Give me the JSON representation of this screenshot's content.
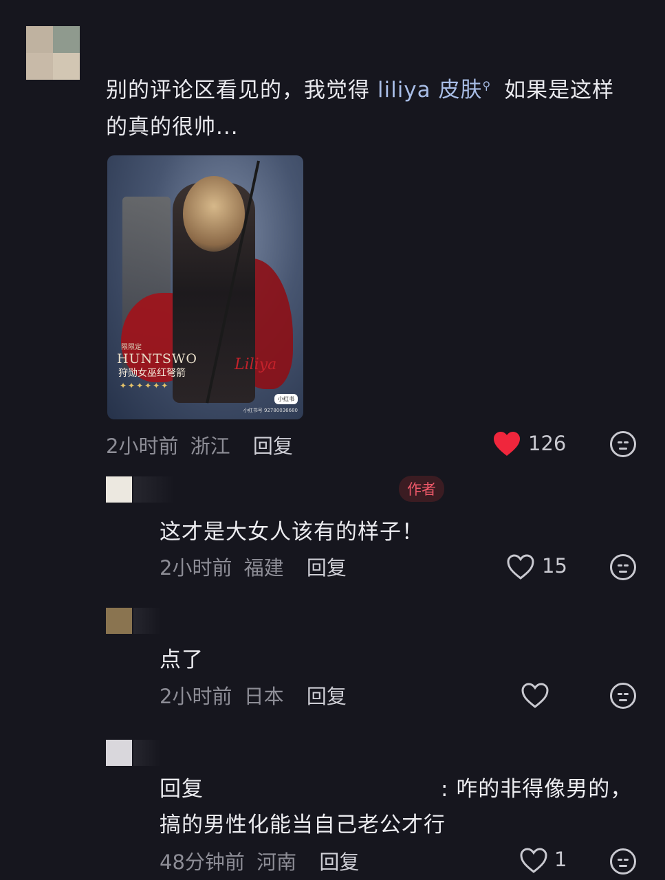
{
  "main_comment": {
    "text_before_link": "别的评论区看见的，我觉得 ",
    "link_text": "liliya 皮肤",
    "search_glyph": "⚲",
    "text_after_link": " 如果是这样的真的很帅...",
    "artwork": {
      "title": "HUNTSWO",
      "subtitle": "狩勋女巫红弩箭",
      "top_label": "限限定",
      "stars": "✦✦✦✦✦✦",
      "signature": "Liliya",
      "badge": "小红书",
      "footer": "小红书号 92780036680"
    },
    "time": "2小时前",
    "location": "浙江",
    "reply_label": "回复",
    "likes": "126",
    "liked": true
  },
  "replies": [
    {
      "tag": "作者",
      "text": "这才是大女人该有的样子！",
      "time": "2小时前",
      "location": "福建",
      "reply_label": "回复",
      "likes": "15"
    },
    {
      "text": "点了",
      "time": "2小时前",
      "location": "日本",
      "reply_label": "回复",
      "likes": ""
    },
    {
      "text_prefix": "回复",
      "text_line1": ": 咋的非得像男的，",
      "text_line2": "搞的男性化能当自己老公才行",
      "time": "48分钟前",
      "location": "河南",
      "reply_label": "回复",
      "likes": "1"
    }
  ],
  "colors": {
    "background": "#16161e",
    "like_active": "#f0263c",
    "link": "#a8bde6",
    "author_tag": "#f0596a"
  }
}
